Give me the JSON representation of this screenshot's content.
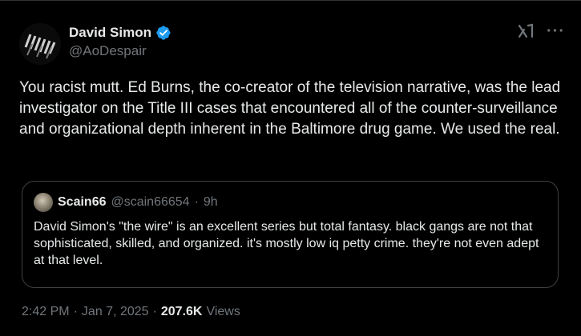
{
  "author": {
    "display_name": "David Simon",
    "handle": "@AoDespair",
    "verified_color": "#1d9bf0"
  },
  "header_actions": {
    "grok_icon": "grok-icon",
    "more_label": "···"
  },
  "tweet": {
    "text": "You racist mutt.  Ed Burns, the co-creator of the television narrative, was the lead investigator on the Title III cases that encountered all of the counter-surveillance and organizational depth inherent in the Baltimore drug game. We used the real."
  },
  "quoted_tweet": {
    "display_name": "Scain66",
    "handle": "@scain66654",
    "separator": "·",
    "time": "9h",
    "text": "David Simon's \"the wire\" is an excellent series but total fantasy. black gangs are not that sophisticated, skilled, and organized. it's mostly low iq petty crime. they're not even adept at that level."
  },
  "meta": {
    "time": "2:42 PM",
    "sep1": "·",
    "date": "Jan 7, 2025",
    "sep2": "·",
    "views_count": "207.6K",
    "views_label": "Views"
  }
}
